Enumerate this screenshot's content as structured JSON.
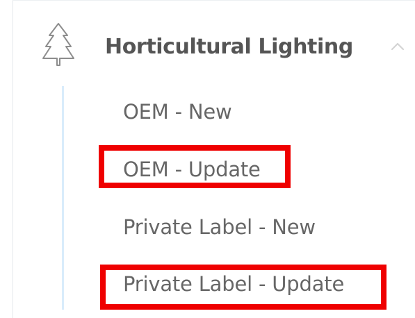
{
  "section": {
    "title": "Horticultural Lighting",
    "icon": "tree-icon",
    "collapse_icon": "chevron-up-icon"
  },
  "navigation": {
    "items": [
      {
        "label": "OEM - New"
      },
      {
        "label": "OEM - Update"
      },
      {
        "label": "Private Label - New"
      },
      {
        "label": "Private Label - Update"
      }
    ]
  },
  "colors": {
    "section_title": "#555555",
    "menu_text": "#666666",
    "rail": "#d9ecfb",
    "highlight": "#ef0000"
  }
}
